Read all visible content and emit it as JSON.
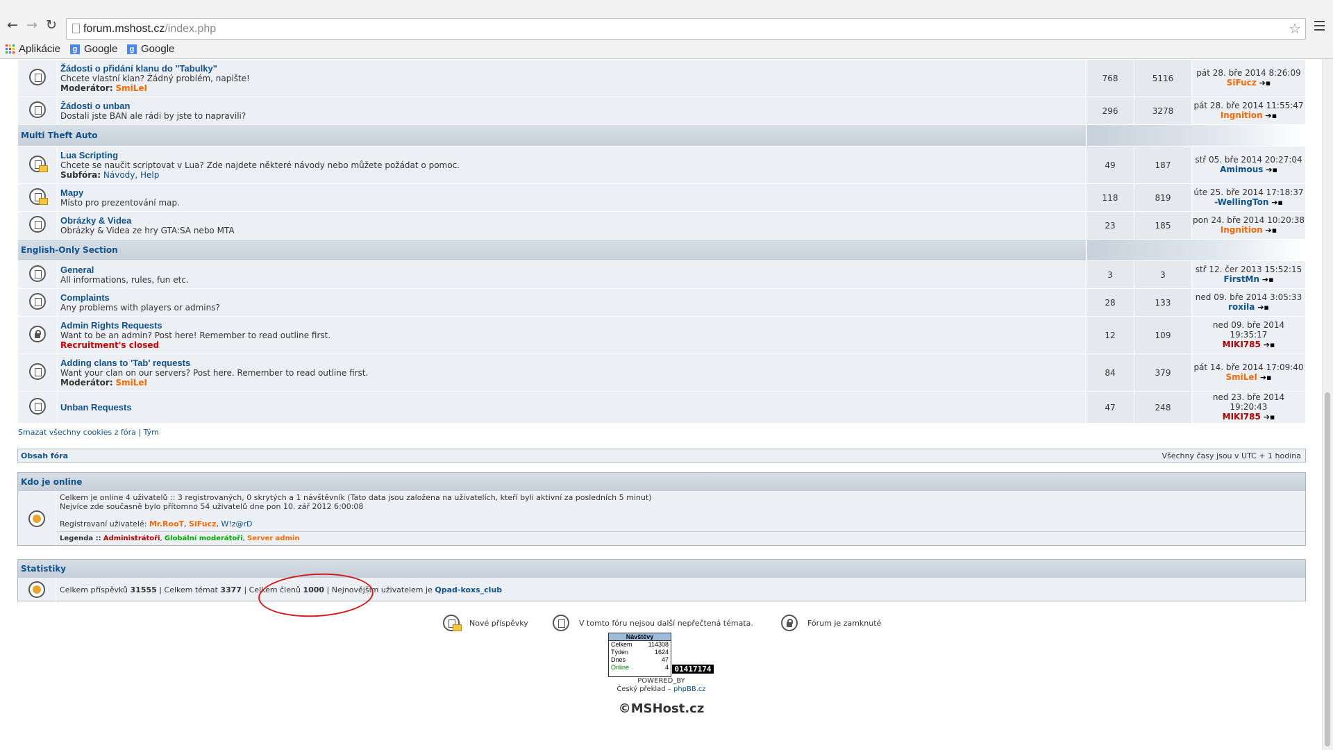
{
  "browser": {
    "url_host": "forum.mshost.cz",
    "url_path": "/index.php",
    "bookmarks": [
      "Aplikácie",
      "Google",
      "Google"
    ]
  },
  "forums_top": [
    {
      "title": "Žádosti o přidání klanu do \"Tabulky\"",
      "desc": "Chcete vlastní klan? Žádný problém, napište!",
      "extra_label": "Moderátor:",
      "extra_value": "SmiLeI",
      "extra_class": "orange",
      "topics": "768",
      "posts": "5116",
      "last_date": "pát 28. bře 2014 8:26:09",
      "last_user": "SiFucz",
      "user_class": "orange",
      "icon": "normal"
    },
    {
      "title": "Žádosti o unban",
      "desc": "Dostali jste BAN ale rádi by jste to napravili?",
      "topics": "296",
      "posts": "3278",
      "last_date": "pát 28. bře 2014 11:55:47",
      "last_user": "Ingnition",
      "user_class": "orange",
      "icon": "normal"
    }
  ],
  "categories": [
    {
      "name": "Multi Theft Auto",
      "forums": [
        {
          "title": "Lua Scripting",
          "desc": "Chcete se naučit scriptovat v Lua? Zde najdete některé návody nebo můžete požádat o pomoc.",
          "extra_label": "Subfóra:",
          "extra_value": "Návody, Help",
          "extra_class": "blue",
          "topics": "49",
          "posts": "187",
          "last_date": "stř 05. bře 2014 20:27:04",
          "last_user": "Amimous",
          "user_class": "blue",
          "icon": "new"
        },
        {
          "title": "Mapy",
          "desc": "Místo pro prezentování map.",
          "topics": "118",
          "posts": "819",
          "last_date": "úte 25. bře 2014 17:18:37",
          "last_user": "-WellingTon",
          "user_class": "blue",
          "icon": "new"
        },
        {
          "title": "Obrázky & Videa",
          "desc": "Obrázky & Videa ze hry GTA:SA nebo MTA",
          "topics": "23",
          "posts": "185",
          "last_date": "pon 24. bře 2014 10:20:38",
          "last_user": "Ingnition",
          "user_class": "orange",
          "icon": "normal"
        }
      ]
    },
    {
      "name": "English-Only Section",
      "forums": [
        {
          "title": "General",
          "desc": "All informations, rules, fun etc.",
          "topics": "3",
          "posts": "3",
          "last_date": "stř 12. čer 2013 15:52:15",
          "last_user": "FirstMn",
          "user_class": "blue",
          "icon": "normal"
        },
        {
          "title": "Complaints",
          "desc": "Any problems with players or admins?",
          "topics": "28",
          "posts": "133",
          "last_date": "ned 09. bře 2014 3:05:33",
          "last_user": "roxila",
          "user_class": "blue",
          "icon": "normal"
        },
        {
          "title": "Admin Rights Requests",
          "desc": "Want to be an admin? Post here! Remember to read outline first.",
          "extra_label": "",
          "extra_value": "Recruitment's closed",
          "extra_class": "red",
          "topics": "12",
          "posts": "109",
          "last_date": "ned 09. bře 2014 19:35:17",
          "last_user": "MIKI785",
          "user_class": "darkred",
          "icon": "lock"
        },
        {
          "title": "Adding clans to 'Tab' requests",
          "desc": "Want your clan on our servers? Post here. Remember to read outline first.",
          "extra_label": "Moderátor:",
          "extra_value": "SmiLeI",
          "extra_class": "orange",
          "topics": "84",
          "posts": "379",
          "last_date": "pát 14. bře 2014 17:09:40",
          "last_user": "SmiLeI",
          "user_class": "orange",
          "icon": "normal"
        },
        {
          "title": "Unban Requests",
          "desc": "",
          "topics": "47",
          "posts": "248",
          "last_date": "ned 23. bře 2014 19:20:43",
          "last_user": "MIKI785",
          "user_class": "darkred",
          "icon": "normal"
        }
      ]
    }
  ],
  "links": {
    "delete_cookies": "Smazat všechny cookies z fóra",
    "sep": "|",
    "team": "Tým"
  },
  "index_bar": {
    "left": "Obsah fóra",
    "right": "Všechny časy jsou v UTC + 1 hodina"
  },
  "online": {
    "title": "Kdo je online",
    "line1": "Celkem je online 4 uživatelů :: 3 registrovaných, 0 skrytých a 1 návštěvník (Tato data jsou založena na uživatelích, kteří byli aktivní za posledních 5 minut)",
    "line2": "Nejvíce zde současně bylo přítomno 54 uživatelů dne pon 10. zář 2012 6:00:08",
    "reg_label": "Registrovaní uživatelé:",
    "users": [
      "Mr.RooT",
      "SiFucz",
      "W!z@rD"
    ],
    "legend_label": "Legenda ::",
    "legend": [
      "Administrátoři",
      "Globální moderátoři",
      "Server admin"
    ]
  },
  "stats": {
    "title": "Statistiky",
    "posts_label": "Celkem příspěvků",
    "posts": "31555",
    "topics_label": "Celkem témat",
    "topics": "3377",
    "members_label": "Celkem členů",
    "members": "1000",
    "newest_label": "Nejnovějším uživatelem je",
    "newest": "Qpad-koxs_club"
  },
  "legend_icons": [
    "Nové příspěvky",
    "V tomto fóru nejsou další nepřečtená témata.",
    "Fórum je zamknuté"
  ],
  "counter": {
    "title": "Návštěvy",
    "rows": [
      [
        "Celkem",
        "114308"
      ],
      [
        "Týden",
        "1624"
      ],
      [
        "Dnes",
        "47"
      ],
      [
        "Online",
        "4"
      ]
    ],
    "badge": "01417174"
  },
  "powered": "POWERED_BY",
  "translation": "Český překlad –",
  "translation_link": "phpBB.cz",
  "copyright": "©MSHost.cz",
  "colors": {
    "link": "#105289",
    "orange": "#f46b0a",
    "red": "#cc0000",
    "annotation": "#d21b1b"
  }
}
